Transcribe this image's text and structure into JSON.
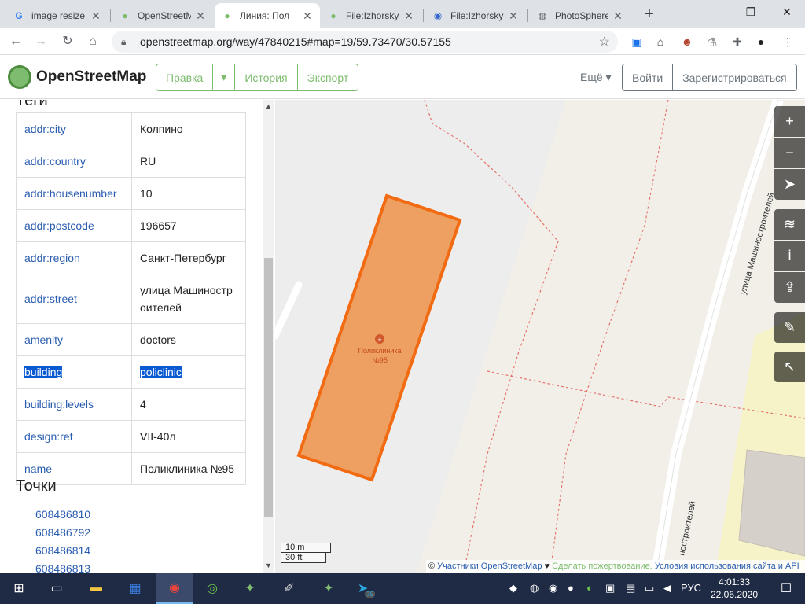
{
  "tabs": [
    {
      "title": "image resize",
      "icon": "google-icon"
    },
    {
      "title": "OpenStreetM",
      "icon": "osm-icon"
    },
    {
      "title": "Линия: Пол",
      "icon": "osm-icon"
    },
    {
      "title": "File:Izhorsky",
      "icon": "wikimedia-icon"
    },
    {
      "title": "File:Izhorsky",
      "icon": "wikimedia-icon"
    },
    {
      "title": "PhotoSphere",
      "icon": "globe-icon"
    }
  ],
  "address": {
    "url": "openstreetmap.org/way/47840215#map=19/59.73470/30.57155"
  },
  "osm": {
    "brand": "OpenStreetMap",
    "edit": "Правка",
    "history": "История",
    "export": "Экспорт",
    "more": "Ещё",
    "login": "Войти",
    "signup": "Зарегистрироваться"
  },
  "sidebar": {
    "cut_heading": "Теги",
    "tags": [
      {
        "key": "addr:city",
        "value": "Колпино"
      },
      {
        "key": "addr:country",
        "value": "RU"
      },
      {
        "key": "addr:housenumber",
        "value": "10"
      },
      {
        "key": "addr:postcode",
        "value": "196657"
      },
      {
        "key": "addr:region",
        "value": "Санкт-Петербург"
      },
      {
        "key": "addr:street",
        "value": "улица Машиностроителей"
      },
      {
        "key": "amenity",
        "value": "doctors"
      },
      {
        "key": "building",
        "value": "policlinic"
      },
      {
        "key": "building:levels",
        "value": "4"
      },
      {
        "key": "design:ref",
        "value": "VII-40л"
      },
      {
        "key": "name",
        "value": "Поликлиника №95"
      }
    ],
    "points_heading": "Точки",
    "points": [
      "608486810",
      "608486792",
      "608486814",
      "608486813"
    ]
  },
  "map": {
    "poi_label_1": "Поликлиника",
    "poi_label_2": "№95",
    "street_label_1": "улица Машиностроителей",
    "street_label_2": "ностроителей",
    "scale_m": "10 m",
    "scale_ft": "30 ft",
    "attribution_prefix": "© ",
    "attribution_contributors": "Участники OpenStreetMap",
    "attribution_donate": "Сделать пожертвование.",
    "attribution_terms": "Условия использования сайта и API",
    "building_fill": "#eda061",
    "building_stroke": "#f26b12"
  },
  "taskbar": {
    "lang": "РУС",
    "time": "4:01:33",
    "date": "22.06.2020",
    "badge": "39"
  }
}
